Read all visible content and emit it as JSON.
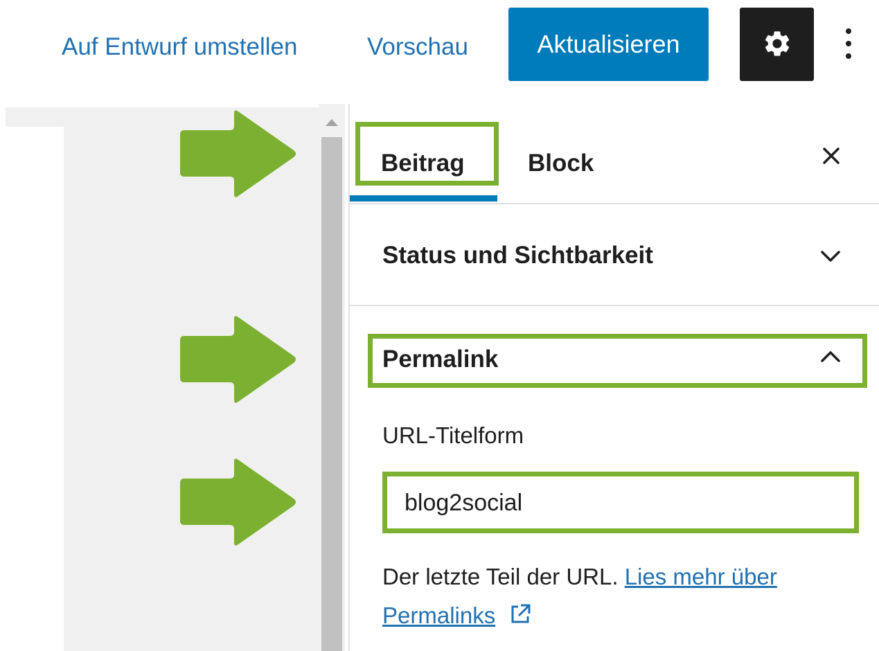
{
  "toolbar": {
    "switch_to_draft_label": "Auf Entwurf umstellen",
    "preview_label": "Vorschau",
    "update_label": "Aktualisieren",
    "settings_icon": "gear-icon",
    "options_icon": "vertical-ellipsis-icon"
  },
  "sidebar": {
    "tabs": [
      {
        "label": "Beitrag",
        "active": true
      },
      {
        "label": "Block",
        "active": false
      }
    ],
    "close_icon": "close-icon",
    "sections": {
      "status": {
        "title": "Status und Sichtbarkeit",
        "expanded": false
      },
      "permalink": {
        "title": "Permalink",
        "expanded": true,
        "slug_label": "URL-Titelform",
        "slug_value": "blog2social",
        "help_text": "Der letzte Teil der URL.",
        "help_link_text": "Lies mehr über Permalinks"
      }
    }
  },
  "colors": {
    "accent": "#007cba",
    "link": "#2271b1",
    "highlight": "#7cb030",
    "dark": "#1e1e1e"
  }
}
